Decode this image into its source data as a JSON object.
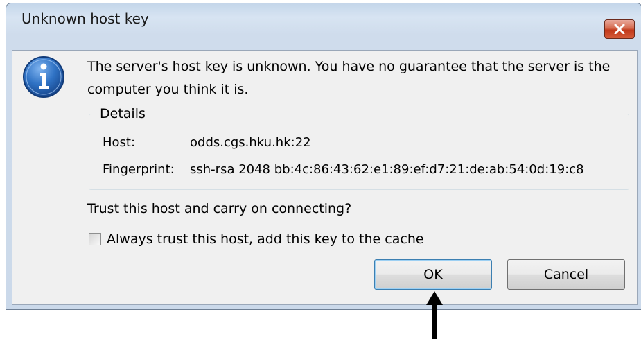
{
  "window": {
    "title": "Unknown host key",
    "close_label": "×"
  },
  "message": {
    "text": "The server's host key is unknown. You have no guarantee that the server is the computer you think it is."
  },
  "details": {
    "legend": "Details",
    "host_label": "Host:",
    "host_value": "odds.cgs.hku.hk:22",
    "fingerprint_label": "Fingerprint:",
    "fingerprint_value": "ssh-rsa 2048 bb:4c:86:43:62:e1:89:ef:d7:21:de:ab:54:0d:19:c8"
  },
  "prompt": "Trust this host and carry on connecting?",
  "checkbox": {
    "label": "Always trust this host, add this key to the cache",
    "checked": false
  },
  "buttons": {
    "ok": "OK",
    "cancel": "Cancel"
  },
  "icons": {
    "info": "info-icon",
    "close": "close-icon",
    "annotation": "arrow-up-icon"
  },
  "colors": {
    "titlebar": "#c4d6ea",
    "client": "#f0f0f0",
    "close_button": "#c1391b",
    "info_icon": "#1f5ea8"
  }
}
